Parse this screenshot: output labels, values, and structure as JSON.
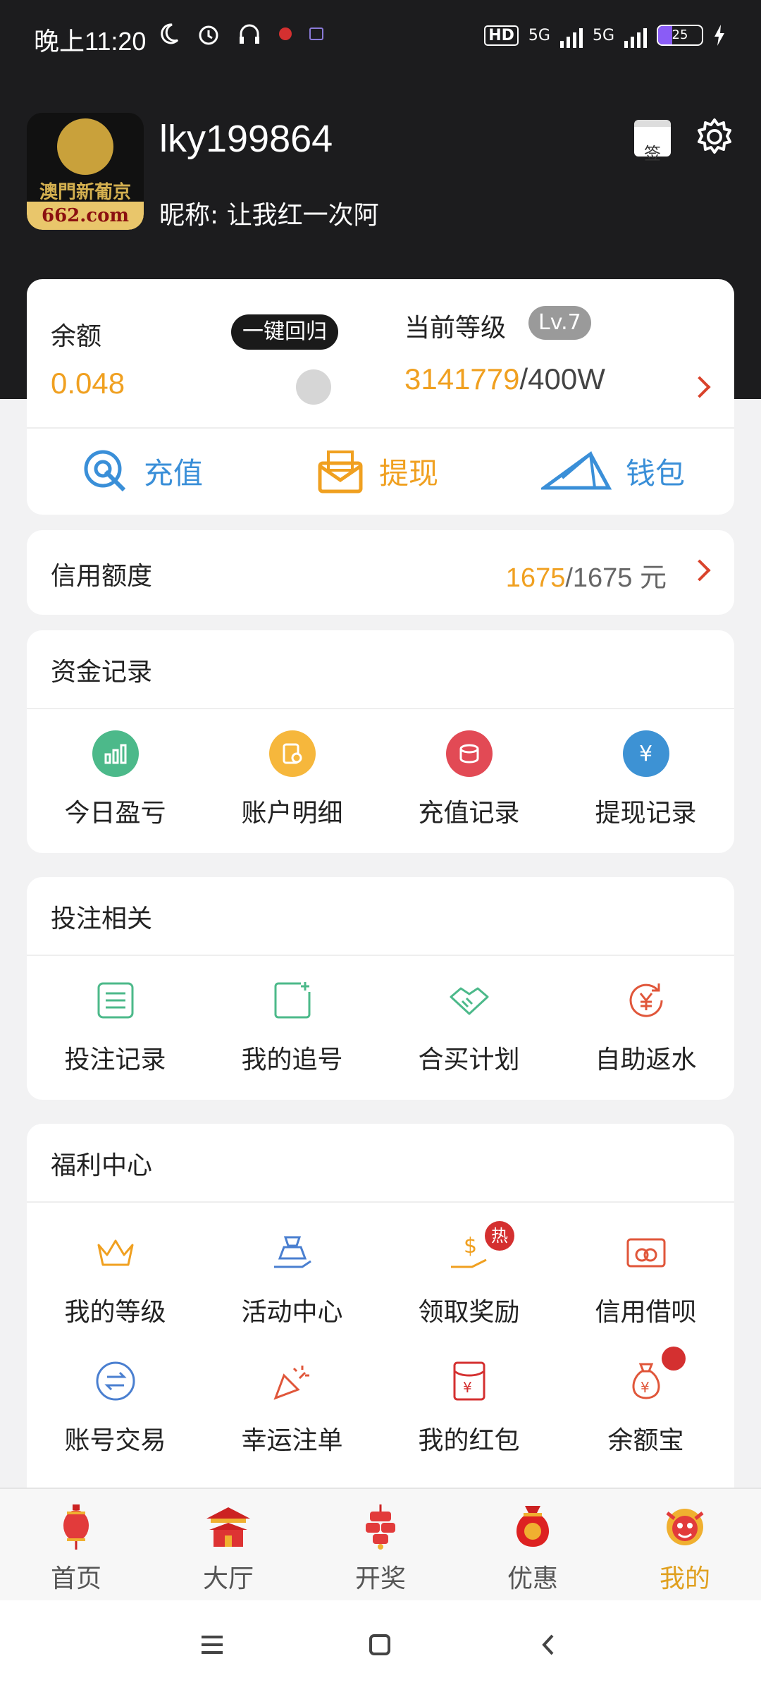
{
  "status_bar": {
    "time": "晚上11:20",
    "battery": "25",
    "net1": "5G",
    "net2": "5G",
    "hd": "HD"
  },
  "profile": {
    "username": "lky199864",
    "nickname": "昵称: 让我红一次阿",
    "avatar_text_cn": "澳門新葡京",
    "avatar_text_domain": "662.com",
    "sign_label": "签"
  },
  "balance": {
    "label": "余额",
    "value": "0.048",
    "one_key_label": "一键回归",
    "level_label": "当前等级",
    "level_badge": "Lv.7",
    "level_current": "3141779",
    "level_target": "/400W"
  },
  "actions": [
    {
      "label": "充值",
      "icon": "recharge-icon",
      "color": "#3a8fd8"
    },
    {
      "label": "提现",
      "icon": "withdraw-envelope-icon",
      "color": "#f0a020"
    },
    {
      "label": "钱包",
      "icon": "wallet-paper-plane-icon",
      "color": "#3a8fd8"
    }
  ],
  "credit": {
    "label": "信用额度",
    "current": "1675",
    "total": "/1675 元"
  },
  "fund_records": {
    "title": "资金记录",
    "items": [
      {
        "label": "今日盈亏",
        "icon": "bar-chart-icon",
        "color": "#4cb98a"
      },
      {
        "label": "账户明细",
        "icon": "document-search-icon",
        "color": "#f6b73c"
      },
      {
        "label": "充值记录",
        "icon": "coins-icon",
        "color": "#e24a55"
      },
      {
        "label": "提现记录",
        "icon": "yen-transfer-icon",
        "color": "#3d92d4"
      }
    ]
  },
  "betting": {
    "title": "投注相关",
    "items": [
      {
        "label": "投注记录",
        "icon": "list-icon",
        "color": "#4cb98a"
      },
      {
        "label": "我的追号",
        "icon": "add-square-icon",
        "color": "#4cb98a"
      },
      {
        "label": "合买计划",
        "icon": "handshake-icon",
        "color": "#4cb98a"
      },
      {
        "label": "自助返水",
        "icon": "yen-refresh-icon",
        "color": "#e0563a"
      }
    ]
  },
  "welfare": {
    "title": "福利中心",
    "items": [
      {
        "label": "我的等级",
        "icon": "crown-icon",
        "color": "#f0a020"
      },
      {
        "label": "活动中心",
        "icon": "gift-hand-icon",
        "color": "#4a7fd0"
      },
      {
        "label": "领取奖励",
        "icon": "dollar-hand-icon",
        "color": "#f0a020",
        "badge": "热"
      },
      {
        "label": "信用借呗",
        "icon": "credit-card-icon",
        "color": "#e0563a"
      },
      {
        "label": "账号交易",
        "icon": "exchange-icon",
        "color": "#4a7fd0"
      },
      {
        "label": "幸运注单",
        "icon": "party-popper-icon",
        "color": "#e0563a"
      },
      {
        "label": "我的红包",
        "icon": "red-envelope-icon",
        "color": "#d43030"
      },
      {
        "label": "余额宝",
        "icon": "money-bag-icon",
        "color": "#e0563a",
        "dot": true
      }
    ]
  },
  "bottom_nav": [
    {
      "label": "首页",
      "icon": "lantern-icon",
      "active": false
    },
    {
      "label": "大厅",
      "icon": "temple-icon",
      "active": false
    },
    {
      "label": "开奖",
      "icon": "firecracker-icon",
      "active": false
    },
    {
      "label": "优惠",
      "icon": "lucky-bag-icon",
      "active": false
    },
    {
      "label": "我的",
      "icon": "lion-dance-icon",
      "active": true
    }
  ]
}
